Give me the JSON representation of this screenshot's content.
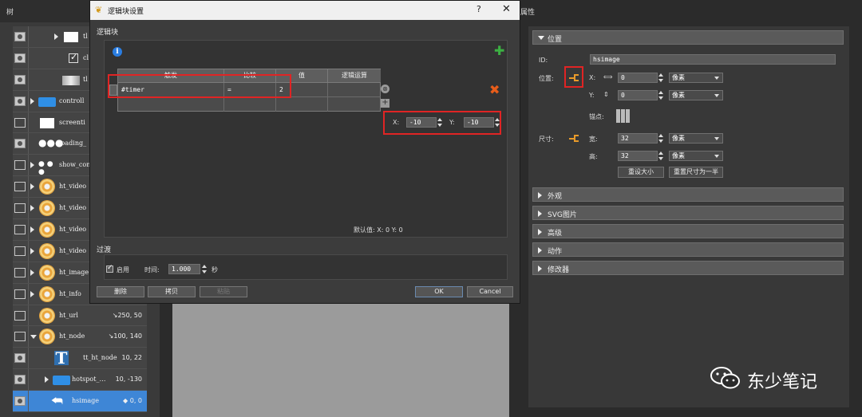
{
  "tree_panel": {
    "header": "树",
    "rows": [
      {
        "label": "tl",
        "value": ""
      },
      {
        "label": "cl",
        "value": ""
      },
      {
        "label": "tl",
        "value": ""
      },
      {
        "label": "controll",
        "value": ""
      },
      {
        "label": "screenti",
        "value": ""
      },
      {
        "label": "loading_",
        "value": ""
      },
      {
        "label": "show_con",
        "value": ""
      },
      {
        "label": "ht_video",
        "value": ""
      },
      {
        "label": "ht_video",
        "value": ""
      },
      {
        "label": "ht_video",
        "value": ""
      },
      {
        "label": "ht_video",
        "value": ""
      },
      {
        "label": "ht_image",
        "value": ""
      },
      {
        "label": "ht_info",
        "value": ""
      },
      {
        "label": "ht_url",
        "value": "↘250, 50"
      },
      {
        "label": "ht_node",
        "value": "↘100, 140"
      },
      {
        "label": "tt_ht_node",
        "value": "10, 22"
      },
      {
        "label": "hotspot_…",
        "value": "10, -130"
      },
      {
        "label": "hsimage",
        "value": "◆ 0, 0"
      }
    ]
  },
  "dialog": {
    "title": "逻辑块设置",
    "help": "?",
    "close": "✕",
    "section_label": "逻辑块",
    "info_icon_text": "i",
    "table": {
      "headers": [
        "触发",
        "比较",
        "值",
        "逻辑运算"
      ],
      "rows": [
        [
          "#timer",
          "=",
          "2",
          ""
        ]
      ]
    },
    "offset": {
      "x_label": "X:",
      "x_value": "-10",
      "y_label": "Y:",
      "y_value": "-10"
    },
    "default_label": "默认值:    X: 0         Y: 0",
    "transition": {
      "label": "过渡",
      "enabled_label": "启用",
      "time_label": "时间:",
      "time_value": "1.000",
      "unit": "秒"
    },
    "buttons": {
      "delete": "删除",
      "copy": "拷贝",
      "paste": "粘贴",
      "ok": "OK",
      "cancel": "Cancel"
    }
  },
  "properties": {
    "header": "属性",
    "sections": {
      "position": "位置",
      "appearance": "外观",
      "svg_image": "SVG图片",
      "advanced": "高级",
      "actions": "动作",
      "modifiers": "修改器"
    },
    "id_label": "ID:",
    "id_value": "hsimage",
    "position_label": "位置:",
    "x_label": "X:",
    "x_value": "0",
    "x_unit": "像素",
    "y_label": "Y:",
    "y_value": "0",
    "y_unit": "像素",
    "anchor_label": "锚点:",
    "size_label": "尺寸:",
    "width_label": "宽:",
    "width_value": "32",
    "width_unit": "像素",
    "height_label": "高:",
    "height_value": "32",
    "height_unit": "像素",
    "reset_size": "重设大小",
    "reset_half": "重置尺寸为一半"
  },
  "watermark": {
    "text": "东少笔记"
  }
}
